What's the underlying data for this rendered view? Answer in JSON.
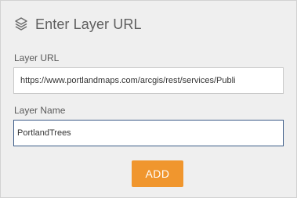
{
  "header": {
    "title": "Enter Layer URL",
    "icon": "layers-icon"
  },
  "form": {
    "url_label": "Layer URL",
    "url_value": "https://www.portlandmaps.com/arcgis/rest/services/Publi",
    "name_label": "Layer Name",
    "name_value": "PortlandTrees"
  },
  "actions": {
    "add_label": "ADD"
  },
  "colors": {
    "accent": "#f0962e",
    "focus_border": "#3b5b87",
    "panel_bg": "#efefef"
  }
}
